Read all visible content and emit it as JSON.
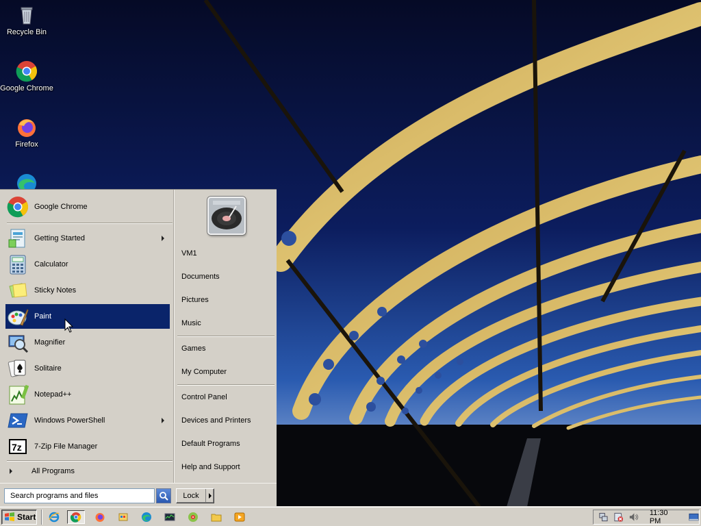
{
  "desktop": {
    "icons": [
      {
        "label": "Recycle Bin",
        "icon": "recycle-bin-icon"
      },
      {
        "label": "Google Chrome",
        "icon": "chrome-icon"
      },
      {
        "label": "Firefox",
        "icon": "firefox-icon"
      },
      {
        "label": "",
        "icon": "edge-icon"
      }
    ]
  },
  "start_menu": {
    "pinned": {
      "label": "Google Chrome",
      "icon": "chrome-icon"
    },
    "programs": [
      {
        "label": "Getting Started",
        "icon": "getting-started-icon",
        "submenu": true
      },
      {
        "label": "Calculator",
        "icon": "calculator-icon",
        "submenu": false
      },
      {
        "label": "Sticky Notes",
        "icon": "sticky-notes-icon",
        "submenu": false
      },
      {
        "label": "Paint",
        "icon": "paint-icon",
        "submenu": false,
        "selected": true
      },
      {
        "label": "Magnifier",
        "icon": "magnifier-icon",
        "submenu": false
      },
      {
        "label": "Solitaire",
        "icon": "solitaire-icon",
        "submenu": false
      },
      {
        "label": "Notepad++",
        "icon": "notepadpp-icon",
        "submenu": false
      },
      {
        "label": "Windows PowerShell",
        "icon": "powershell-icon",
        "submenu": true
      },
      {
        "label": "7-Zip File Manager",
        "icon": "7zip-icon",
        "submenu": false
      }
    ],
    "all_programs_label": "All Programs",
    "search_placeholder": "Search programs and files",
    "right_links": [
      {
        "label": "VM1"
      },
      {
        "label": "Documents"
      },
      {
        "label": "Pictures"
      },
      {
        "label": "Music"
      },
      {
        "label": "Games"
      },
      {
        "label": "My Computer"
      },
      {
        "label": "Control Panel"
      },
      {
        "label": "Devices and Printers"
      },
      {
        "label": "Default Programs"
      },
      {
        "label": "Help and Support"
      }
    ],
    "lock_label": "Lock"
  },
  "taskbar": {
    "start_label": "Start",
    "quick_launch": [
      {
        "icon": "internet-explorer-icon"
      },
      {
        "icon": "chrome-icon"
      },
      {
        "icon": "firefox-icon"
      },
      {
        "icon": "windows-explorer-icon"
      },
      {
        "icon": "edge-icon"
      },
      {
        "icon": "task-manager-icon"
      },
      {
        "icon": "media-icon"
      },
      {
        "icon": "folder-icon"
      },
      {
        "icon": "media-player-icon"
      }
    ],
    "tray_icons": [
      "network-icon",
      "security-alert-icon",
      "volume-icon"
    ],
    "clock": "11:30 PM"
  }
}
